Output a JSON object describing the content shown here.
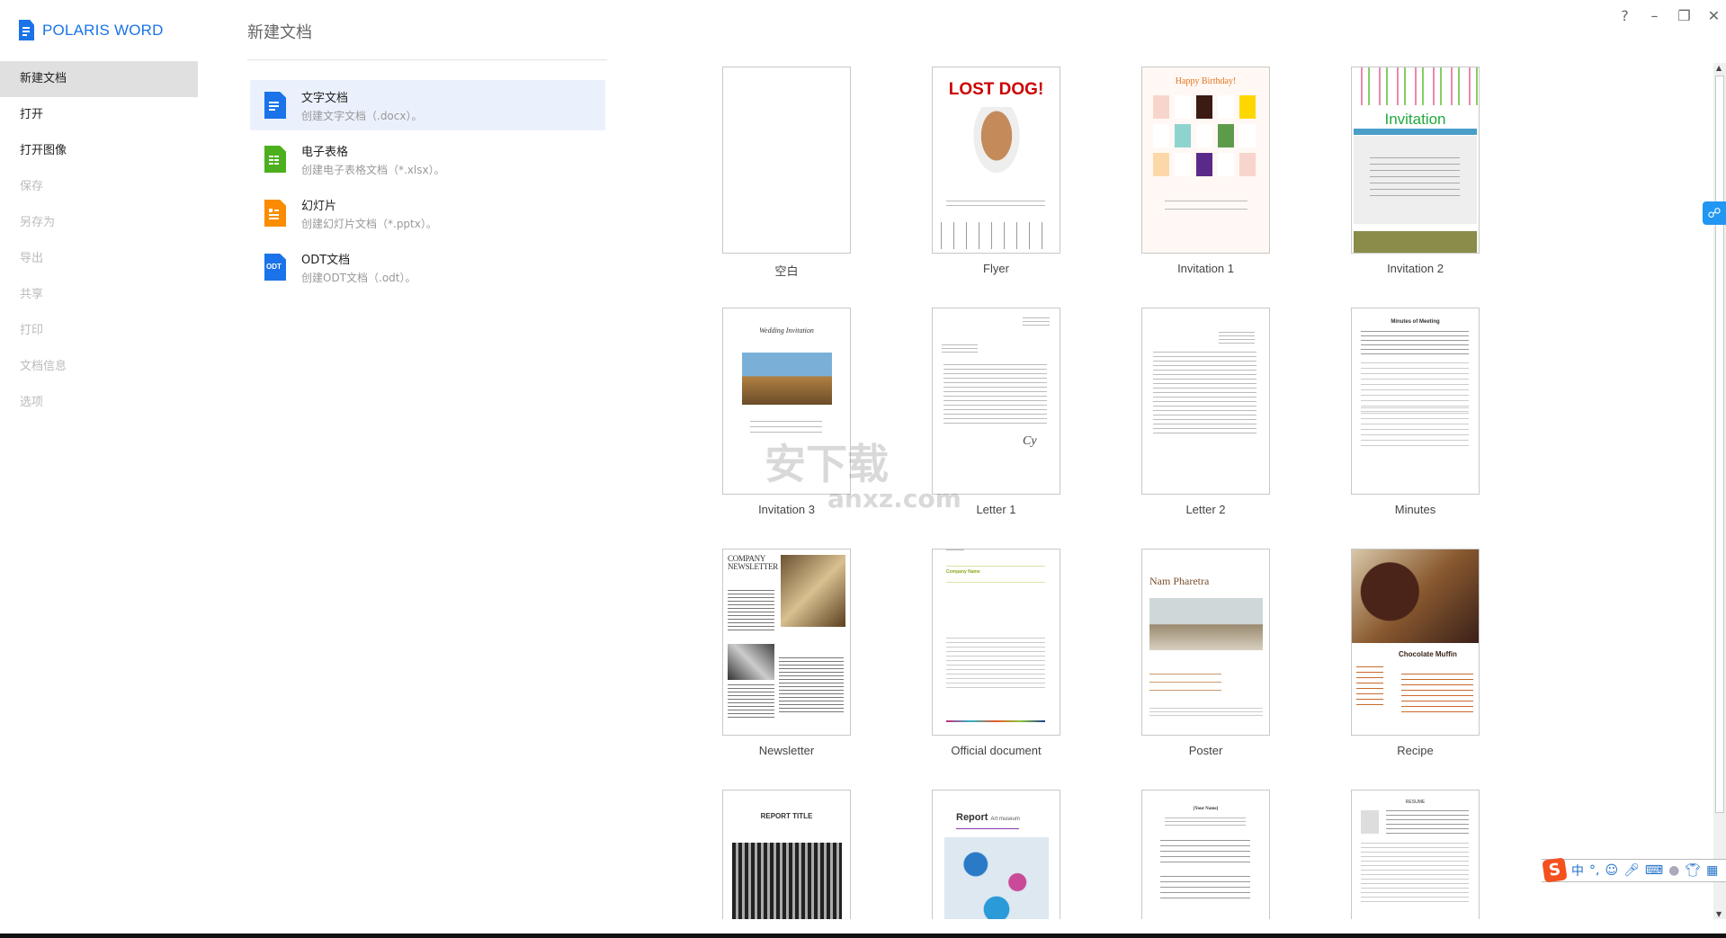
{
  "app": {
    "name": "POLARIS WORD",
    "accent": "#1a73e8"
  },
  "sidebar": {
    "items": [
      {
        "label": "新建文档",
        "state": "selected"
      },
      {
        "label": "打开",
        "state": "enabled"
      },
      {
        "label": "打开图像",
        "state": "enabled"
      },
      {
        "label": "保存",
        "state": "disabled"
      },
      {
        "label": "另存为",
        "state": "disabled"
      },
      {
        "label": "导出",
        "state": "disabled"
      },
      {
        "label": "共享",
        "state": "disabled"
      },
      {
        "label": "打印",
        "state": "disabled"
      },
      {
        "label": "文档信息",
        "state": "disabled"
      },
      {
        "label": "选项",
        "state": "disabled"
      }
    ]
  },
  "main": {
    "title": "新建文档",
    "doc_types": [
      {
        "name": "文字文档",
        "desc": "创建文字文档（.docx）。",
        "icon": "word-doc-icon",
        "color": "#1a73e8"
      },
      {
        "name": "电子表格",
        "desc": "创建电子表格文档（*.xlsx）。",
        "icon": "sheet-doc-icon",
        "color": "#4caf1e"
      },
      {
        "name": "幻灯片",
        "desc": "创建幻灯片文档（*.pptx）。",
        "icon": "slide-doc-icon",
        "color": "#fb8c00"
      },
      {
        "name": "ODT文档",
        "desc": "创建ODT文档（.odt）。",
        "icon": "odt-doc-icon",
        "color": "#1a73e8",
        "badge": "ODT"
      }
    ]
  },
  "templates": [
    {
      "label": "空白"
    },
    {
      "label": "Flyer",
      "preview": "LOST DOG!"
    },
    {
      "label": "Invitation 1",
      "preview": "Happy Birthday!"
    },
    {
      "label": "Invitation 2",
      "preview": "Invitation"
    },
    {
      "label": "Invitation 3",
      "preview": "Wedding Invitation"
    },
    {
      "label": "Letter 1"
    },
    {
      "label": "Letter 2"
    },
    {
      "label": "Minutes",
      "preview": "Minutes of Meeting"
    },
    {
      "label": "Newsletter",
      "preview": "COMPANY NEWSLETTER"
    },
    {
      "label": "Official document",
      "preview": "Company Name"
    },
    {
      "label": "Poster",
      "preview": "Nam Pharetra"
    },
    {
      "label": "Recipe",
      "preview": "Chocolate Muffin"
    },
    {
      "label": "",
      "preview": "REPORT TITLE"
    },
    {
      "label": "",
      "preview": "Report",
      "preview2": "Art museum"
    },
    {
      "label": "",
      "preview": "[Your Name]"
    },
    {
      "label": "",
      "preview": "RESUME"
    }
  ],
  "window": {
    "help": "?",
    "minimize": "–",
    "restore": "❐",
    "close": "✕"
  },
  "ime": {
    "mode": "中",
    "punct": "°,"
  },
  "watermark": {
    "text": "安下载",
    "sub": "anxz.com"
  }
}
